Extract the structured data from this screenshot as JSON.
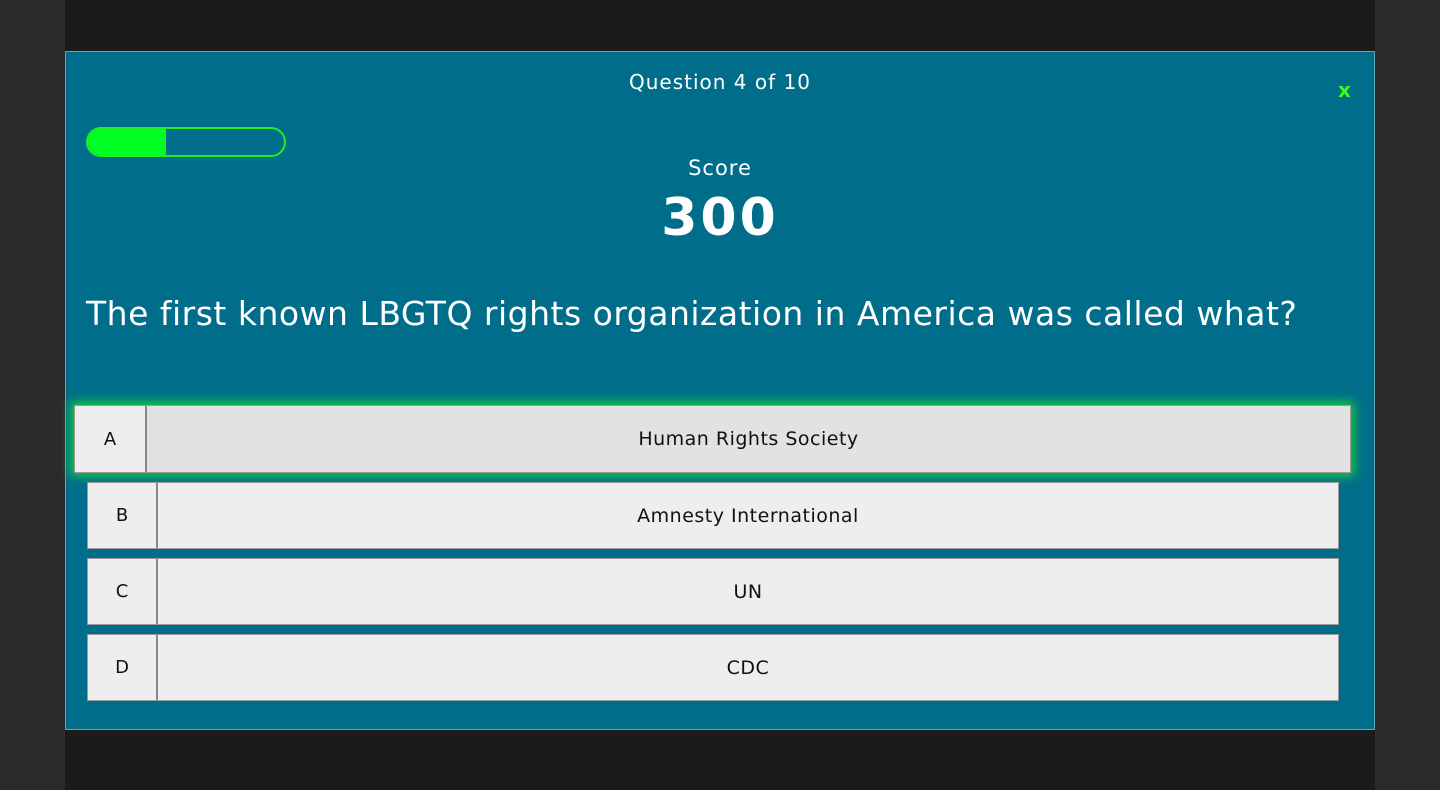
{
  "quiz": {
    "progress_text": "Question 4 of 10",
    "close_label": "x",
    "progress_fraction": 0.4,
    "score_label": "Score",
    "score_value": "300",
    "question": "The first known LBGTQ rights organization in America was called what?",
    "answers": [
      {
        "letter": "A",
        "text": "Human Rights Society",
        "selected": true
      },
      {
        "letter": "B",
        "text": "Amnesty International",
        "selected": false
      },
      {
        "letter": "C",
        "text": "UN",
        "selected": false
      },
      {
        "letter": "D",
        "text": "CDC",
        "selected": false
      }
    ]
  },
  "colors": {
    "modal_background": "#006e8a",
    "accent_green": "#39ff14",
    "progress_fill": "#00ff22",
    "backdrop": "#1b1b1b"
  }
}
